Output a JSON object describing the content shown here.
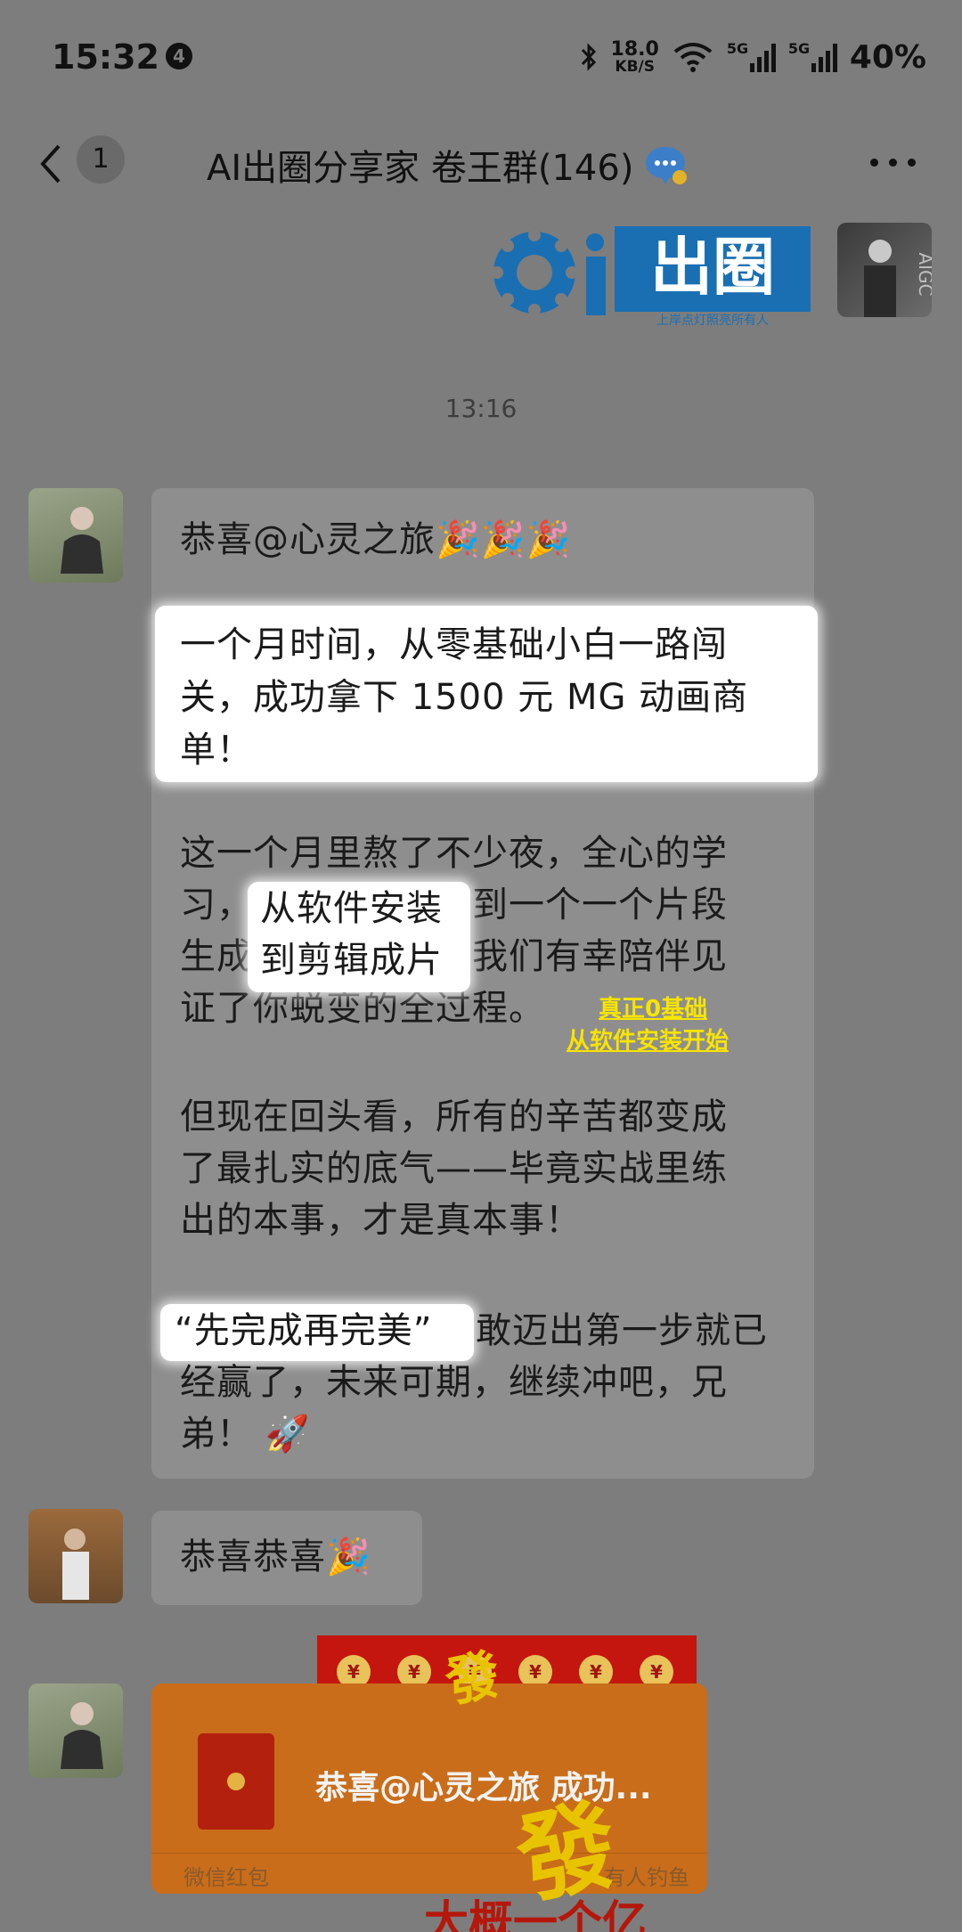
{
  "status_bar": {
    "time": "15:32",
    "notification_count": "4",
    "net_speed_value": "18.0",
    "net_speed_unit": "KB/S",
    "signal1_label": "5G",
    "signal2_label": "5G",
    "battery": "40%"
  },
  "header": {
    "back_count": "1",
    "title": "AI出圈分享家 卷王群(146)"
  },
  "logo": {
    "brand_text": "出圈",
    "slogan": "上岸点灯照亮所有人",
    "avatar_text": "AIGC"
  },
  "chat": {
    "timestamp": "13:16",
    "msg1": {
      "greeting": "恭喜@心灵之旅",
      "highlight": [
        "一个月时间，从零基础小白一路闯",
        "关，成功拿下 1500 元 MG 动画商",
        "单！"
      ],
      "p2_lines": [
        "这一个月里熬了不少夜，全心的学",
        "习，从软件安装，到一个一个片段",
        "生成到剪辑成片！我们有幸陪伴见",
        "证了你蜕变的全过程。"
      ],
      "p2_hl": [
        "从软件安装",
        "到剪辑成片"
      ],
      "annotation": [
        "真正0基础",
        "从软件安装开始"
      ],
      "p3_lines": [
        "但现在回头看，所有的辛苦都变成",
        "了最扎实的底气——毕竟实战里练",
        "出的本事，才是真本事！"
      ],
      "p4_hl": "“先完成再完美”",
      "p4_lines": [
        "敢迈出第一步就已",
        "经赢了，未来可期，继续冲吧，兄",
        "弟！"
      ]
    },
    "msg2": {
      "text": "恭喜恭喜"
    },
    "red_packet": {
      "title": "恭喜@心灵之旅 成功...",
      "footer": "微信红包",
      "footer_right": "有人钓鱼",
      "coin": "¥",
      "fa": "發"
    },
    "overlay_caption": "大概一个亿"
  },
  "colors": {
    "overlay_bg": "#7d7d7d",
    "bubble": "#8e8e8e",
    "highlight": "#ffffff",
    "annotation": "#f7e400",
    "red_packet": "#c96d1a",
    "logo_blue": "#1a6fb3"
  }
}
